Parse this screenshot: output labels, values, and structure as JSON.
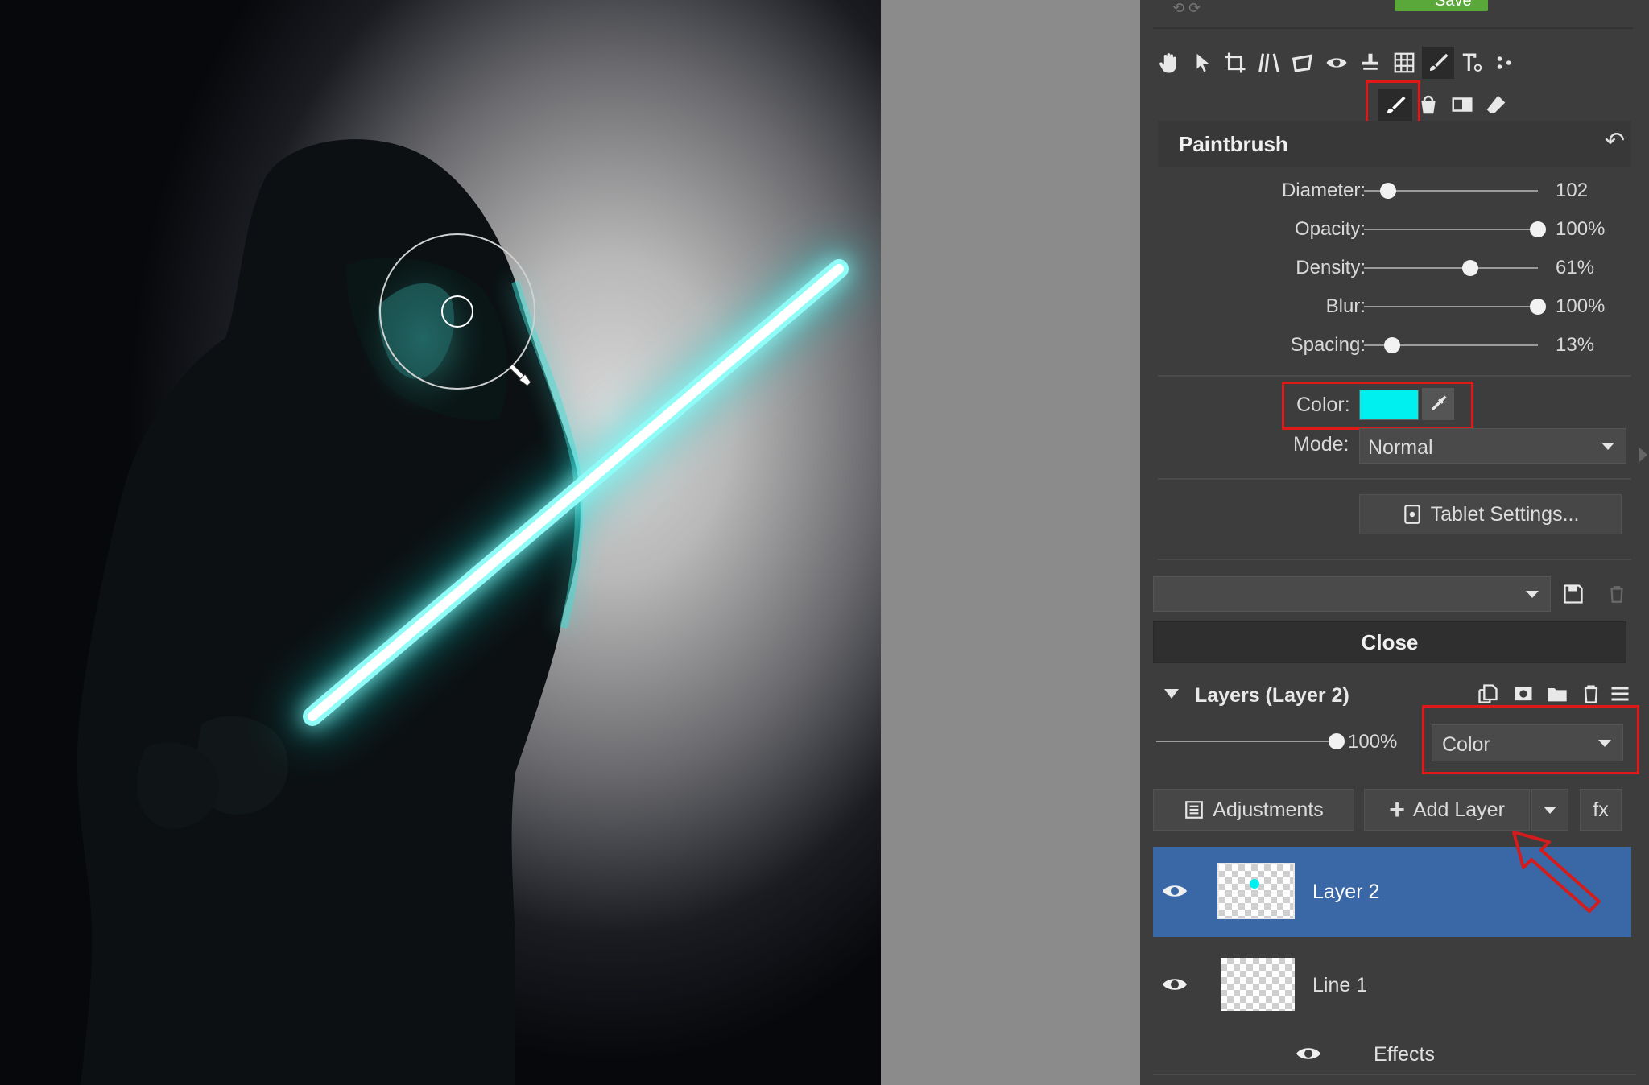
{
  "toolbar": {
    "save_label": "Save",
    "tool_icons": [
      "hand-icon",
      "select-arrow-icon",
      "crop-icon",
      "perspective-icon",
      "transform-icon",
      "red-eye-icon",
      "clone-stamp-icon",
      "grid-icon",
      "brush-tools-icon",
      "text-icon",
      "dots-icon"
    ],
    "subtool_icons": [
      "paintbrush-icon",
      "paint-bucket-icon",
      "gradient-icon",
      "eraser-icon"
    ]
  },
  "paintbrush": {
    "title": "Paintbrush",
    "sliders": [
      {
        "label": "Diameter:",
        "value_text": "102",
        "level": 0.14
      },
      {
        "label": "Opacity:",
        "value_text": "100%",
        "level": 1.0
      },
      {
        "label": "Density:",
        "value_text": "61%",
        "level": 0.61
      },
      {
        "label": "Blur:",
        "value_text": "100%",
        "level": 1.0
      },
      {
        "label": "Spacing:",
        "value_text": "13%",
        "level": 0.16
      }
    ],
    "color_label": "Color:",
    "color_value": "#00f0f0",
    "mode_label": "Mode:",
    "mode_value": "Normal",
    "tablet_settings_label": "Tablet Settings...",
    "preset_value": "",
    "close_label": "Close"
  },
  "layers": {
    "title": "Layers (Layer 2)",
    "opacity_text": "100%",
    "opacity_level": 1.0,
    "blend_mode": "Color",
    "adjustments_label": "Adjustments",
    "add_layer_label": "Add Layer",
    "fx_label": "fx",
    "items": [
      {
        "name": "Layer 2",
        "selected": true
      },
      {
        "name": "Line 1",
        "selected": false
      }
    ],
    "effects_label": "Effects"
  },
  "colors": {
    "panel_bg": "#3d3d3d",
    "accent_selected": "#3a67a6",
    "highlight_box": "#e01818",
    "brush_color": "#00f0f0",
    "save_green": "#5aa83a"
  }
}
